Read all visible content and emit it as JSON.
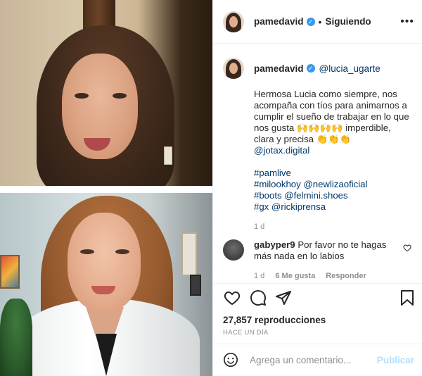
{
  "header": {
    "username": "pamedavid",
    "separator": "•",
    "follow_status": "Siguiendo",
    "more_icon": "more-horizontal-icon"
  },
  "caption": {
    "username": "pamedavid",
    "mention": "@lucia_ugarte",
    "lines": [
      "Hermosa Lucia como siempre, nos",
      "acompaña con tíos para animarnos a",
      "cumplir el sueño de trabajar en lo que",
      "nos gusta 🙌🙌🙌🙌 imperdible,",
      "clara y precisa 👏👏👏"
    ],
    "link1": "@jotax.digital",
    "tags": [
      "#pamlive",
      "#milookhoy @newlizaoficial",
      "#boots @felmini.shoes",
      "#gx @rickiprensa"
    ],
    "time": "1 d"
  },
  "comment": {
    "username": "gabyper9",
    "text": "Por favor no te hagas más nada en lo labios",
    "time": "1 d",
    "likes": "6 Me gusta",
    "reply": "Responder"
  },
  "actions": {
    "views": "27,857 reproducciones",
    "when": "HACE UN DÍA"
  },
  "add_comment": {
    "placeholder": "Agrega un comentario...",
    "publish": "Publicar"
  },
  "colors": {
    "link": "#00376b",
    "verified": "#3897f0",
    "muted": "#8e8e8e",
    "publish_disabled": "#b2dffc"
  }
}
